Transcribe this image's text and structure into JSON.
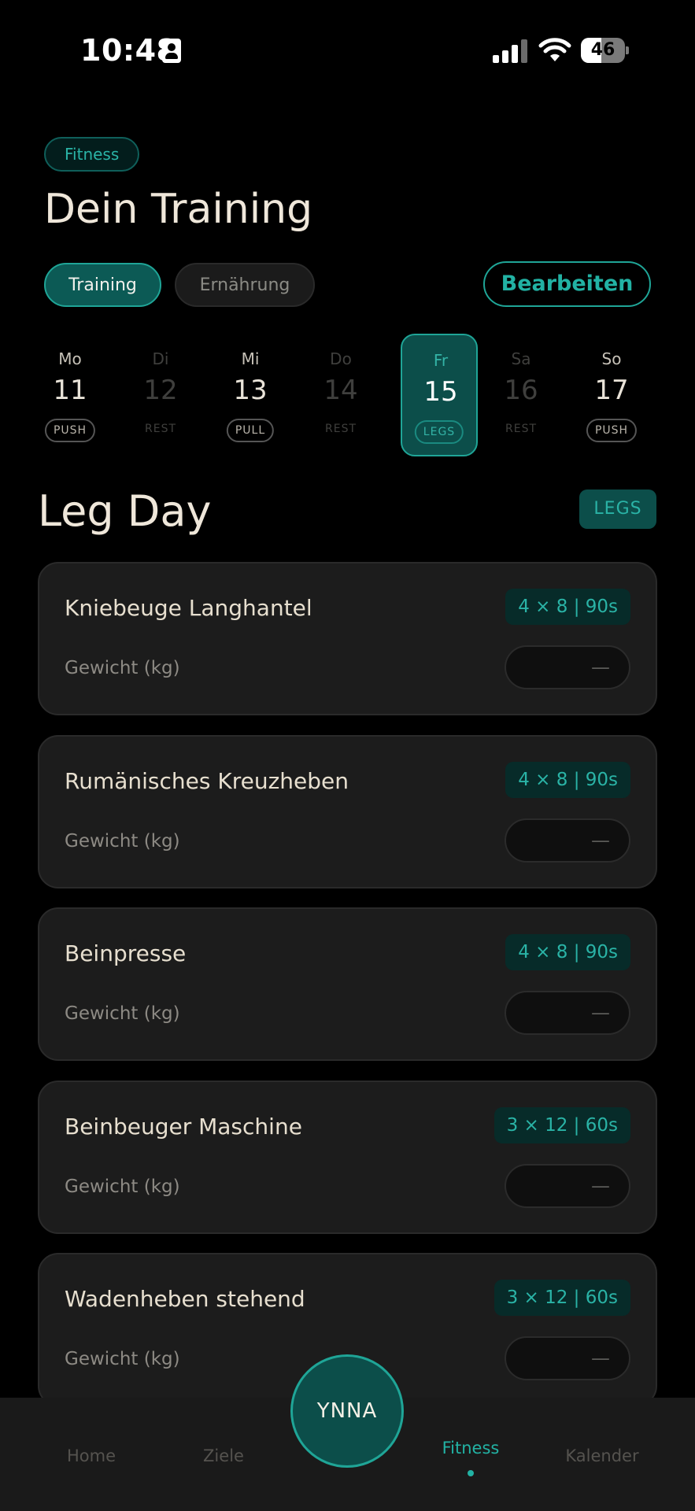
{
  "status_bar": {
    "time": "10:48",
    "battery": "46",
    "battery_level": 0.46
  },
  "header": {
    "category": "Fitness",
    "title": "Dein Training",
    "segments": {
      "training": "Training",
      "nutrition": "Ernährung"
    },
    "edit_label": "Bearbeiten"
  },
  "week": [
    {
      "dow": "Mo",
      "num": "11",
      "tag": "PUSH",
      "state": "active"
    },
    {
      "dow": "Di",
      "num": "12",
      "tag": "REST",
      "state": "rest"
    },
    {
      "dow": "Mi",
      "num": "13",
      "tag": "PULL",
      "state": "active"
    },
    {
      "dow": "Do",
      "num": "14",
      "tag": "REST",
      "state": "rest"
    },
    {
      "dow": "Fr",
      "num": "15",
      "tag": "LEGS",
      "state": "selected"
    },
    {
      "dow": "Sa",
      "num": "16",
      "tag": "REST",
      "state": "rest"
    },
    {
      "dow": "So",
      "num": "17",
      "tag": "PUSH",
      "state": "active"
    }
  ],
  "section": {
    "title": "Leg Day",
    "badge": "LEGS"
  },
  "exercises": [
    {
      "name": "Kniebeuge Langhantel",
      "scheme": "4 × 8  |  90s",
      "weight_label": "Gewicht (kg)",
      "weight_value": "—"
    },
    {
      "name": "Rumänisches Kreuzheben",
      "scheme": "4 × 8  |  90s",
      "weight_label": "Gewicht (kg)",
      "weight_value": "—"
    },
    {
      "name": "Beinpresse",
      "scheme": "4 × 8  |  90s",
      "weight_label": "Gewicht (kg)",
      "weight_value": "—"
    },
    {
      "name": "Beinbeuger Maschine",
      "scheme": "3 × 12  |  60s",
      "weight_label": "Gewicht (kg)",
      "weight_value": "—"
    },
    {
      "name": "Wadenheben stehend",
      "scheme": "3 × 12  |  60s",
      "weight_label": "Gewicht (kg)",
      "weight_value": "—"
    }
  ],
  "tab_bar": {
    "home": "Home",
    "goals": "Ziele",
    "center": "YNNA",
    "fitness": "Fitness",
    "calendar": "Kalender"
  },
  "colors": {
    "accent": "#1fa597",
    "accent_dark": "#0c4e4a",
    "background": "#000000",
    "card": "#1c1c1c"
  },
  "icons": [
    "contact-card-icon",
    "cellular-signal-icon",
    "wifi-icon",
    "battery-icon"
  ]
}
